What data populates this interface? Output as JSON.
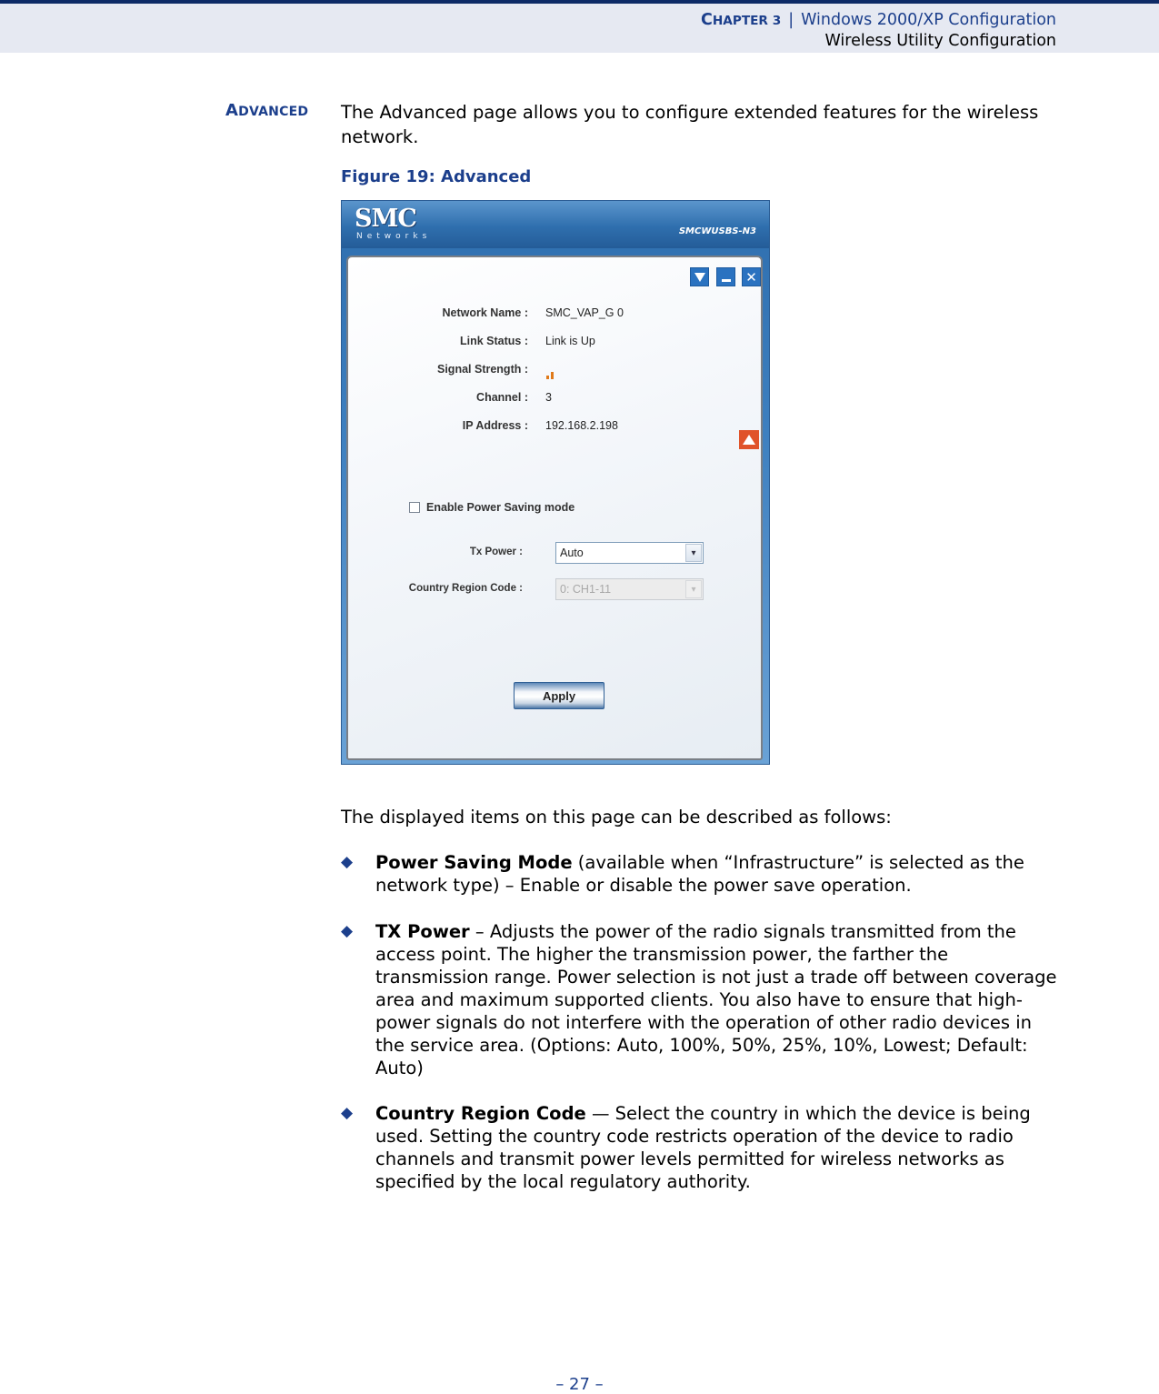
{
  "header": {
    "chapter_label": "Chapter 3",
    "separator": "|",
    "chapter_title": "Windows 2000/XP Configuration",
    "section_title": "Wireless Utility Configuration"
  },
  "section": {
    "label": "Advanced",
    "intro": "The Advanced page allows you to configure extended features for the wireless network."
  },
  "figure": {
    "caption": "Figure 19:  Advanced",
    "app": {
      "logo": "SMC",
      "logo_sub": "Networks",
      "model": "SMCWUSBS-N3",
      "window_buttons": {
        "dropdown_icon": "triangle-down-icon",
        "minimize_icon": "minimize-icon",
        "close_icon": "close-icon",
        "close_glyph": "✕"
      },
      "status": [
        {
          "label": "Network Name :",
          "value": "SMC_VAP_G 0"
        },
        {
          "label": "Link Status :",
          "value": "Link is Up"
        },
        {
          "label": "Signal Strength :",
          "value": ""
        },
        {
          "label": "Channel :",
          "value": "3"
        },
        {
          "label": "IP Address :",
          "value": "192.168.2.198"
        }
      ],
      "signal_strength_bars": 2,
      "signal_color": "#e07a1a",
      "collapse_icon": "triangle-up-icon",
      "power_saving": {
        "label": "Enable Power Saving mode",
        "checked": false
      },
      "tx_power": {
        "label": "Tx Power :",
        "value": "Auto",
        "arrow": "▾"
      },
      "country_region": {
        "label": "Country Region Code :",
        "value": "0: CH1-11",
        "disabled": true,
        "arrow": "▾"
      },
      "apply_label": "Apply"
    }
  },
  "description_intro": "The displayed items on this page can be described as follows:",
  "bullets": [
    {
      "term": "Power Saving Mode",
      "text": " (available when “Infrastructure” is selected as the network type) – Enable or disable the power save operation."
    },
    {
      "term": "TX Power",
      "text": " – Adjusts the power of the radio signals transmitted from the access point. The higher the transmission power, the farther the transmission range. Power selection is not just a trade off between coverage area and maximum supported clients. You also have to ensure that high-power signals do not interfere with the operation of other radio devices in the service area. (Options: Auto, 100%, 50%, 25%, 10%, Lowest; Default: Auto)"
    },
    {
      "term": "Country Region Code",
      "text": " — Select the country in which the device is being used. Setting the country code restricts operation of the device to radio channels and transmit power levels permitted for wireless networks as specified by the local regulatory authority."
    }
  ],
  "bullet_glyph": "◆",
  "footer": {
    "page": "–  27  –"
  },
  "colors": {
    "accent": "#1c3f8c",
    "header_bg": "#e6e9f2",
    "header_rule": "#0d2a66"
  }
}
